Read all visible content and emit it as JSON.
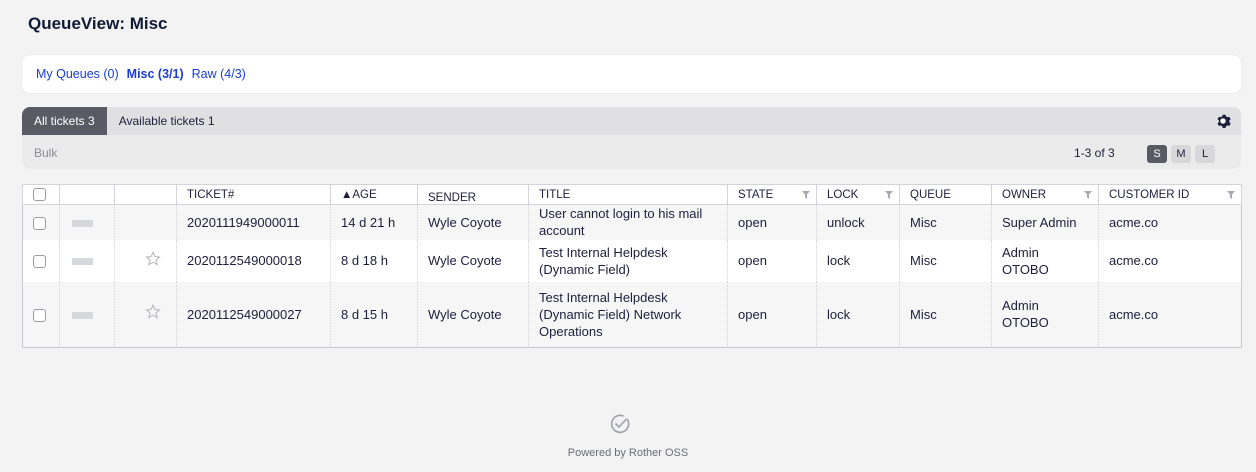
{
  "page": {
    "title": "QueueView: Misc"
  },
  "queues": [
    {
      "label": "My Queues (0)",
      "active": false
    },
    {
      "label": "Misc (3/1)",
      "active": true
    },
    {
      "label": "Raw (4/3)",
      "active": false
    }
  ],
  "tabs": {
    "all": "All tickets 3",
    "available": "Available tickets 1"
  },
  "toolbar": {
    "bulk": "Bulk",
    "pager": "1-3 of 3",
    "size_s": "S",
    "size_m": "M",
    "size_l": "L"
  },
  "table": {
    "headers": {
      "ticket": "TICKET#",
      "age": "▲AGE",
      "sender": "SENDER",
      "title": "TITLE",
      "state": "STATE",
      "lock": "LOCK",
      "queue": "QUEUE",
      "owner": "OWNER",
      "customer": "CUSTOMER ID"
    },
    "rows": [
      {
        "ticket": "2020111949000011",
        "age": "14 d 21 h",
        "sender": "Wyle Coyote",
        "title": "User cannot login to his mail account",
        "state": "open",
        "lock": "unlock",
        "queue": "Misc",
        "owner": "Super Admin",
        "customer": "acme.co",
        "starred": false
      },
      {
        "ticket": "2020112549000018",
        "age": "8 d 18 h",
        "sender": "Wyle Coyote",
        "title": "Test Internal Helpdesk (Dynamic Field)",
        "state": "open",
        "lock": "lock",
        "queue": "Misc",
        "owner": "Admin OTOBO",
        "customer": "acme.co",
        "starred": true
      },
      {
        "ticket": "2020112549000027",
        "age": "8 d 15 h",
        "sender": "Wyle Coyote",
        "title": "Test Internal Helpdesk (Dynamic Field) Network Operations",
        "state": "open",
        "lock": "lock",
        "queue": "Misc",
        "owner": "Admin OTOBO",
        "customer": "acme.co",
        "starred": true
      }
    ]
  },
  "footer": {
    "text": "Powered by Rother OSS"
  },
  "colors": {
    "link": "#1a3fd0",
    "active_tab": "#585b63",
    "background": "#f3f3f4"
  },
  "icons": {
    "settings": "gear-icon",
    "star": "star-icon",
    "filter": "filter-icon",
    "footer": "checkmark-circle-icon"
  }
}
